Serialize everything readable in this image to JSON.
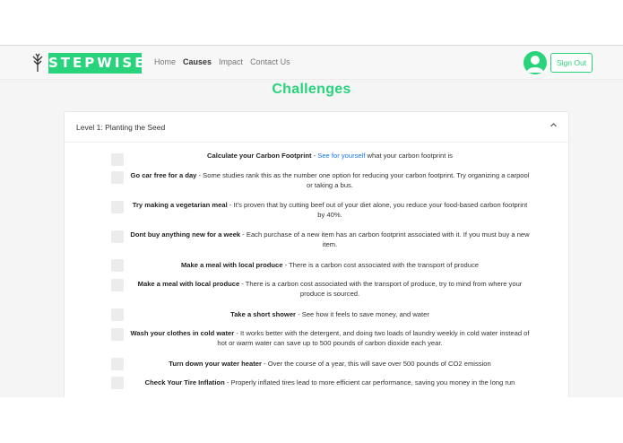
{
  "brand": {
    "name": "STEPWISE",
    "accent": "#28d37c"
  },
  "nav": {
    "links": [
      "Home",
      "Causes",
      "Impact",
      "Contact Us"
    ],
    "active": "Causes"
  },
  "account": {
    "signout_label": "Sign Out"
  },
  "page": {
    "title": "Challenges"
  },
  "level": {
    "title": "Level 1: Planting the Seed"
  },
  "challenges": [
    {
      "title": "Calculate your Carbon Footprint",
      "desc_pre": " - ",
      "link": "See for yourself",
      "desc": " what your carbon footprint is"
    },
    {
      "title": "Go car free for a day",
      "desc_pre": " - ",
      "link": "",
      "desc": "Some studies rank this as the number one option for reducing your carbon footprint. Try organizing a carpool or taking a bus."
    },
    {
      "title": "Try making a vegetarian meal",
      "desc_pre": " - ",
      "link": "",
      "desc": "It's proven that by cutting beef out of your diet alone, you reduce your food-based carbon footprint by 40%."
    },
    {
      "title": "Dont buy anything new for a week",
      "desc_pre": " - ",
      "link": "",
      "desc": "Each purchase of a new item has an carbon footprint associated with it. If you must buy a new item."
    },
    {
      "title": "Make a meal with local produce",
      "desc_pre": " - ",
      "link": "",
      "desc": "There is a carbon cost associated with the transport of produce"
    },
    {
      "title": "Make a meal with local produce",
      "desc_pre": " - ",
      "link": "",
      "desc": "There is a carbon cost associated with the transport of produce, try to mind from where your produce is sourced."
    },
    {
      "title": "Take a short shower",
      "desc_pre": " - ",
      "link": "",
      "desc": "See how it feels to save money, and water"
    },
    {
      "title": "Wash your clothes in cold water",
      "desc_pre": " - ",
      "link": "",
      "desc": "It works better with the detergent, and doing two loads of laundry weekly in cold water instead of hot or warm water can save up to 500 pounds of carbon dioxide each year."
    },
    {
      "title": "Turn down your water heater",
      "desc_pre": " - ",
      "link": "",
      "desc": "Over the course of a year, this will save over 500 pounds of CO2 emission"
    },
    {
      "title": "Check Your Tire Inflation",
      "desc_pre": " - ",
      "link": "",
      "desc": "Properly inflated tires lead to more efficient car performance, saving you money in the long run"
    }
  ]
}
